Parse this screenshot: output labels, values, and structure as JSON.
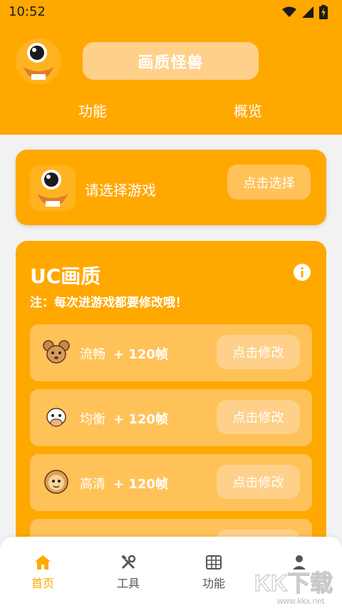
{
  "status": {
    "time": "10:52"
  },
  "header": {
    "title": "画质怪兽",
    "tabs": [
      "功能",
      "概览"
    ]
  },
  "select_card": {
    "prompt": "请选择游戏",
    "button": "点击选择"
  },
  "quality": {
    "title": "UC画质",
    "note": "注：每次进游戏都要修改哦！",
    "rows": [
      {
        "label": "流畅",
        "fps": "+ 120帧",
        "button": "点击修改",
        "icon": "mouse-icon"
      },
      {
        "label": "均衡",
        "fps": "+ 120帧",
        "button": "点击修改",
        "icon": "cow-icon"
      },
      {
        "label": "高清",
        "fps": "+ 120帧",
        "button": "点击修改",
        "icon": "tiger-icon"
      }
    ]
  },
  "nav": [
    {
      "label": "首页",
      "icon": "home-icon",
      "active": true
    },
    {
      "label": "工具",
      "icon": "tools-icon",
      "active": false
    },
    {
      "label": "功能",
      "icon": "grid-icon",
      "active": false
    },
    {
      "label": "",
      "icon": "user-icon",
      "active": false
    }
  ],
  "watermark": {
    "brand": "KK下载",
    "url": "www.kkx.net"
  },
  "colors": {
    "primary": "#ffa800",
    "row_bg": "#ffc258",
    "pill_bg": "#ffd089",
    "active_nav": "#ffa800"
  }
}
